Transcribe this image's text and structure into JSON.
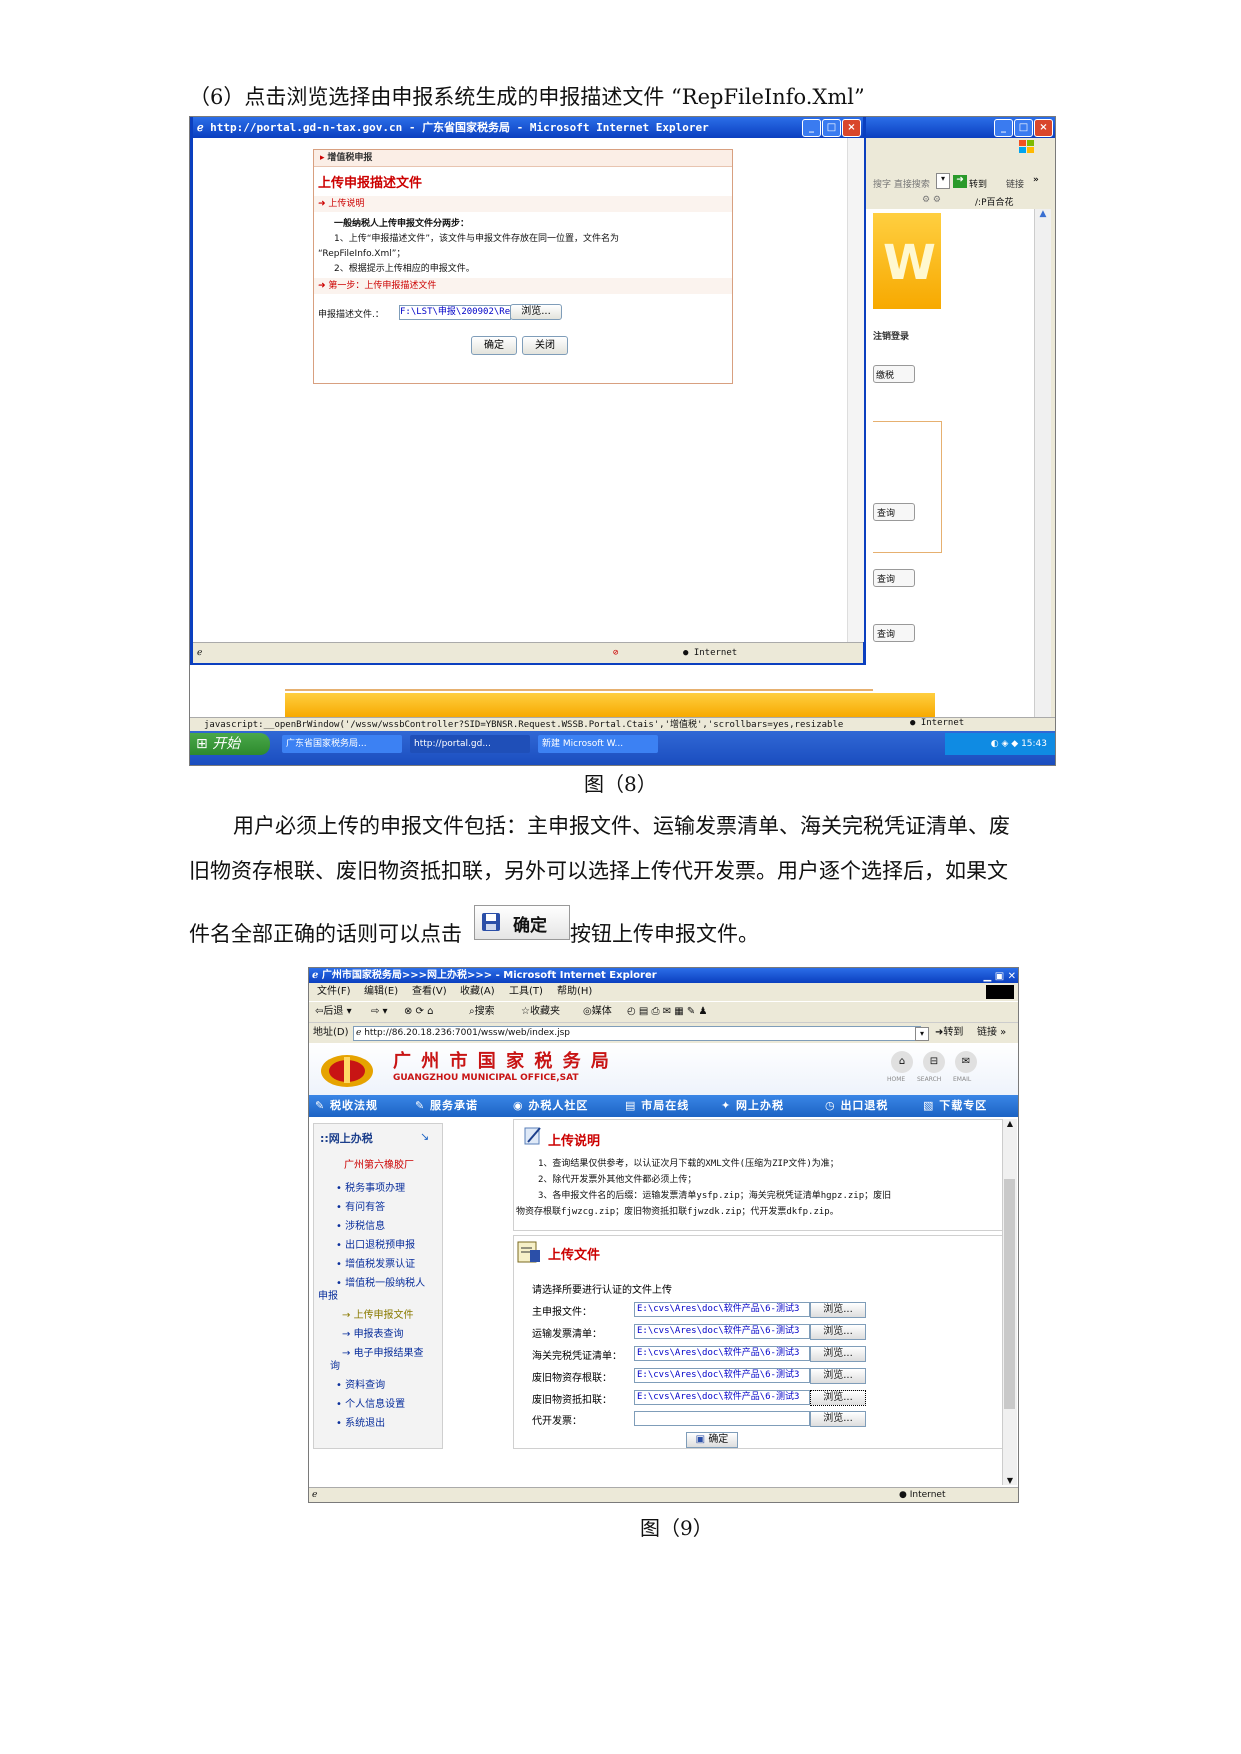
{
  "doc": {
    "step6_text": "（6）点击浏览选择由申报系统生成的申报描述文件 “RepFileInfo.Xml”",
    "caption_8": "图（8）",
    "para1_line1": "用户必须上传的申报文件包括：主申报文件、运输发票清单、海关完税凭证清单、废",
    "para1_line2": "旧物资存根联、废旧物资抵扣联，另外可以选择上传代开发票。用户逐个选择后，如果文",
    "para1_line3_before": "件名全部正确的话则可以点击",
    "para1_button_label": "确定",
    "para1_line3_after": "按钮上传申报文件。",
    "caption_9": "图（9）"
  },
  "shot1": {
    "popup_title": "http://portal.gd-n-tax.gov.cn - 广东省国家税务局 - Microsoft Internet Explorer",
    "panel_header": "增值税申报",
    "panel_title": "上传申报描述文件",
    "section_upload_note": "上传说明",
    "note_bold": "一般纳税人上传申报文件分两步：",
    "note_line1": "1、上传“申报描述文件”，该文件与申报文件存放在同一位置，文件名为",
    "note_line2": "“RepFileInfo.Xml”；",
    "note_line3": "2、根据提示上传相应的申报文件。",
    "section_step1": "第一步：上传申报描述文件",
    "field_label": "申报描述文件.：",
    "field_value": "F:\\LST\\申报\\200902\\Re",
    "browse_label": "浏览...",
    "ok_label": "确定",
    "close_label": "关闭",
    "popup_status": "Internet",
    "bg_search_text": "搜字  直接搜索",
    "bg_goto": "转到",
    "bg_links": "链接",
    "bg_address_tail": "/:P百合花",
    "bg_logout": "注销登录",
    "bg_tax": "缴税",
    "bg_query1": "查询",
    "bg_query2": "查询",
    "bg_query3": "查询",
    "statusbar_text": "javascript:__openBrWindow('/wssw/wssbController?SID=YBNSR.Request.WSSB.Portal.Ctais','增值税','scrollbars=yes,resizable",
    "statusbar_zone": "Internet",
    "taskbar": {
      "start": "开始",
      "items": [
        "广东省国家税务局...",
        "http://portal.gd...",
        "新建 Microsoft W..."
      ],
      "clock": "15:43"
    }
  },
  "shot2": {
    "title": "广州市国家税务局>>>网上办税>>> - Microsoft Internet Explorer",
    "menu": [
      "文件(F)",
      "编辑(E)",
      "查看(V)",
      "收藏(A)",
      "工具(T)",
      "帮助(H)"
    ],
    "toolbar": {
      "back": "后退",
      "search": "搜索",
      "favorites": "收藏夹",
      "media": "媒体"
    },
    "address_label": "地址(D)",
    "address_value": "http://86.20.18.236:7001/wssw/web/index.jsp",
    "goto": "转到",
    "links": "链接",
    "site_title": "广 州 市 国 家 税 务 局",
    "site_subtitle": "GUANGZHOU MUNICIPAL OFFICE,SAT",
    "top_icons": [
      "HOME",
      "SEARCH",
      "EMAIL"
    ],
    "nav": [
      "税收法规",
      "服务承诺",
      "办税人社区",
      "市局在线",
      "网上办税",
      "出口退税",
      "下载专区"
    ],
    "sidebar": {
      "title": "::网上办税",
      "company": "广州第六橡胶厂",
      "items": [
        "税务事项办理",
        "有问有答",
        "涉税信息",
        "出口退税预申报",
        "增值税发票认证",
        "增值税一般纳税人",
        "申报"
      ],
      "subitems": [
        "上传申报文件",
        "申报表查询",
        "电子申报结果查",
        "询"
      ],
      "items2": [
        "资料查询",
        "个人信息设置",
        "系统退出"
      ]
    },
    "notes_title": "上传说明",
    "notes": [
      "1、查询结果仅供参考，以认证次月下载的XML文件(压缩为ZIP文件)为准；",
      "2、除代开发票外其他文件都必须上传；",
      "3、各申报文件名的后缀：运输发票清单ysfp.zip；海关完税凭证清单hgpz.zip；废旧",
      "物资存根联fjwzcg.zip；废旧物资抵扣联fjwzdk.zip；代开发票dkfp.zip。"
    ],
    "upload_title": "上传文件",
    "upload_prompt": "请选择所要进行认证的文件上传",
    "rows": [
      {
        "label": "主申报文件：",
        "value": "E:\\cvs\\Ares\\doc\\软件产品\\6-测试3"
      },
      {
        "label": "运输发票清单：",
        "value": "E:\\cvs\\Ares\\doc\\软件产品\\6-测试3"
      },
      {
        "label": "海关完税凭证清单：",
        "value": "E:\\cvs\\Ares\\doc\\软件产品\\6-测试3"
      },
      {
        "label": "废旧物资存根联：",
        "value": "E:\\cvs\\Ares\\doc\\软件产品\\6-测试3"
      },
      {
        "label": "废旧物资抵扣联：",
        "value": "E:\\cvs\\Ares\\doc\\软件产品\\6-测试3"
      },
      {
        "label": "代开发票：",
        "value": ""
      }
    ],
    "browse_label": "浏览...",
    "submit_label": "确定",
    "status_zone": "Internet"
  },
  "colors": {
    "xp_blue": "#0b3fbf",
    "panel_red": "#cc0000",
    "nav_blue": "#1c63c4",
    "orange": "#f7a900"
  }
}
